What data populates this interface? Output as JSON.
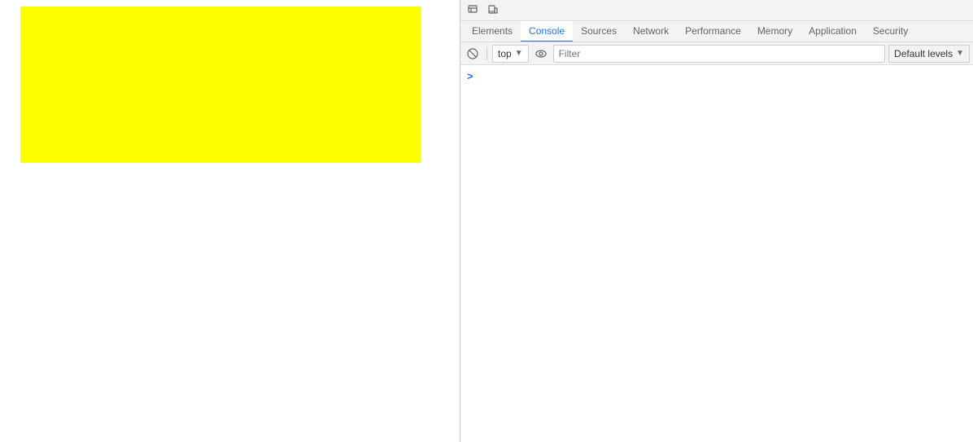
{
  "browser_page": {
    "yellow_box": {
      "color": "#ffff00"
    }
  },
  "devtools": {
    "toolbar": {
      "inspect_icon": "⬚",
      "device_icon": "⬜"
    },
    "tabs": [
      {
        "label": "Elements",
        "active": false
      },
      {
        "label": "Console",
        "active": true
      },
      {
        "label": "Sources",
        "active": false
      },
      {
        "label": "Network",
        "active": false
      },
      {
        "label": "Performance",
        "active": false
      },
      {
        "label": "Memory",
        "active": false
      },
      {
        "label": "Application",
        "active": false
      },
      {
        "label": "Security",
        "active": false
      }
    ],
    "console_toolbar": {
      "clear_icon": "🚫",
      "context_label": "top",
      "filter_placeholder": "Filter",
      "default_levels_label": "Default levels"
    },
    "console_content": {
      "caret": ">"
    }
  }
}
